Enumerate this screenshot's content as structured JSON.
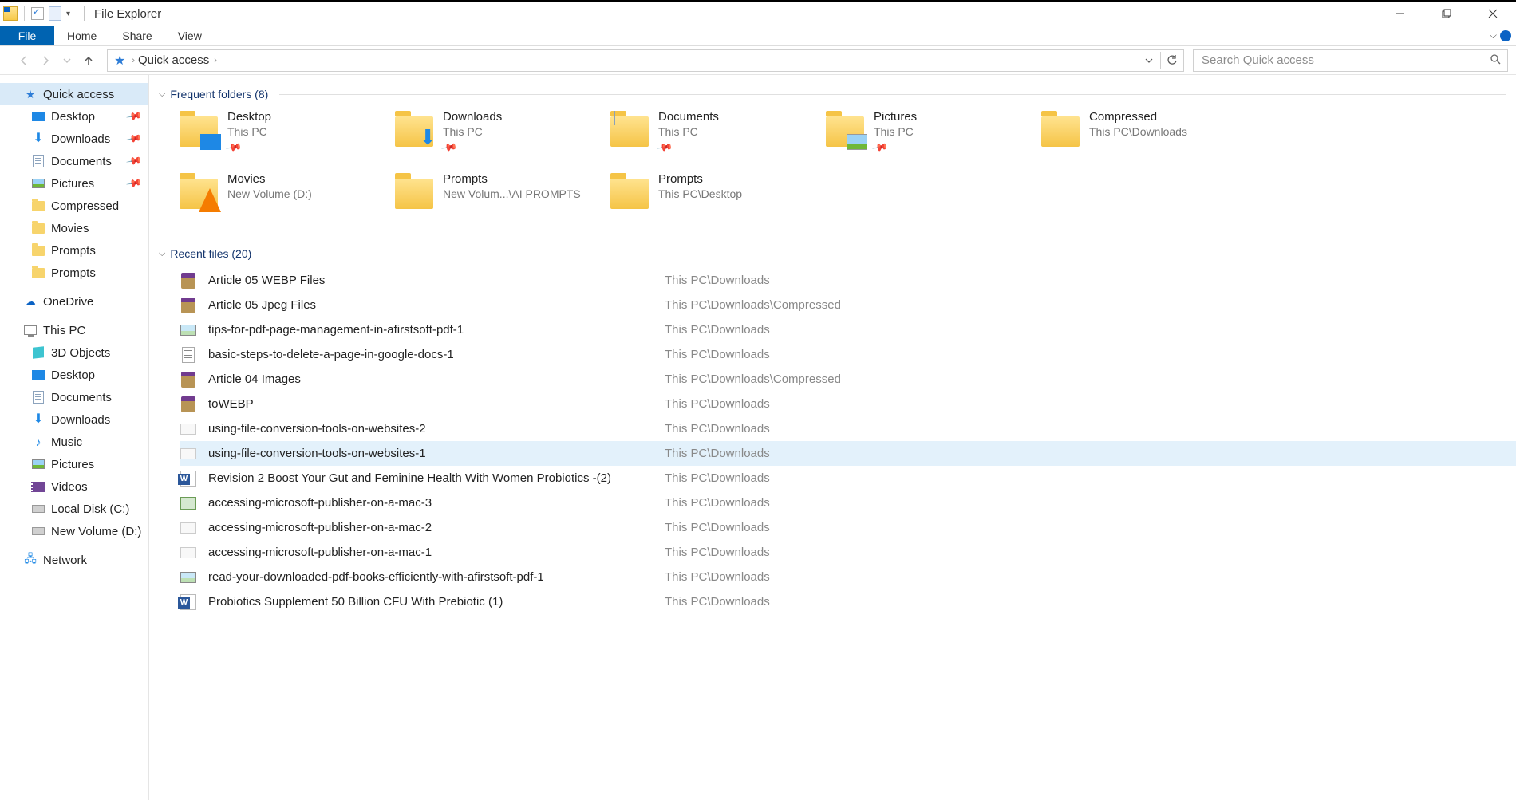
{
  "window": {
    "title": "File Explorer"
  },
  "ribbon": {
    "file": "File",
    "home": "Home",
    "share": "Share",
    "view": "View"
  },
  "address": {
    "location": "Quick access",
    "search_placeholder": "Search Quick access"
  },
  "navpane": {
    "quick_access": "Quick access",
    "qa_items": [
      {
        "label": "Desktop",
        "pinned": true
      },
      {
        "label": "Downloads",
        "pinned": true
      },
      {
        "label": "Documents",
        "pinned": true
      },
      {
        "label": "Pictures",
        "pinned": true
      },
      {
        "label": "Compressed",
        "pinned": false
      },
      {
        "label": "Movies",
        "pinned": false
      },
      {
        "label": "Prompts",
        "pinned": false
      },
      {
        "label": "Prompts",
        "pinned": false
      }
    ],
    "onedrive": "OneDrive",
    "this_pc": "This PC",
    "pc_items": [
      {
        "label": "3D Objects"
      },
      {
        "label": "Desktop"
      },
      {
        "label": "Documents"
      },
      {
        "label": "Downloads"
      },
      {
        "label": "Music"
      },
      {
        "label": "Pictures"
      },
      {
        "label": "Videos"
      },
      {
        "label": "Local Disk (C:)"
      },
      {
        "label": "New Volume (D:)"
      }
    ],
    "network": "Network"
  },
  "section1": {
    "title": "Frequent folders (8)"
  },
  "folders": [
    {
      "name": "Desktop",
      "path": "This PC",
      "pinned": true,
      "overlay": "desktop"
    },
    {
      "name": "Downloads",
      "path": "This PC",
      "pinned": true,
      "overlay": "down"
    },
    {
      "name": "Documents",
      "path": "This PC",
      "pinned": true,
      "overlay": "doc"
    },
    {
      "name": "Pictures",
      "path": "This PC",
      "pinned": true,
      "overlay": "pic"
    },
    {
      "name": "Compressed",
      "path": "This PC\\Downloads",
      "pinned": false,
      "overlay": ""
    },
    {
      "name": "Movies",
      "path": "New Volume (D:)",
      "pinned": false,
      "overlay": "vlc"
    },
    {
      "name": "Prompts",
      "path": "New Volum...\\AI PROMPTS",
      "pinned": false,
      "overlay": ""
    },
    {
      "name": "Prompts",
      "path": "This PC\\Desktop",
      "pinned": false,
      "overlay": ""
    }
  ],
  "section2": {
    "title": "Recent files (20)"
  },
  "files": [
    {
      "name": "Article 05 WEBP Files",
      "path": "This PC\\Downloads",
      "icon": "rar",
      "sel": false
    },
    {
      "name": "Article 05 Jpeg Files",
      "path": "This PC\\Downloads\\Compressed",
      "icon": "rar",
      "sel": false
    },
    {
      "name": "tips-for-pdf-page-management-in-afirstsoft-pdf-1",
      "path": "This PC\\Downloads",
      "icon": "img",
      "sel": false
    },
    {
      "name": "basic-steps-to-delete-a-page-in-google-docs-1",
      "path": "This PC\\Downloads",
      "icon": "txt",
      "sel": false
    },
    {
      "name": "Article 04 Images",
      "path": "This PC\\Downloads\\Compressed",
      "icon": "rar",
      "sel": false
    },
    {
      "name": "toWEBP",
      "path": "This PC\\Downloads",
      "icon": "rar",
      "sel": false
    },
    {
      "name": "using-file-conversion-tools-on-websites-2",
      "path": "This PC\\Downloads",
      "icon": "imgw",
      "sel": false
    },
    {
      "name": "using-file-conversion-tools-on-websites-1",
      "path": "This PC\\Downloads",
      "icon": "imgw",
      "sel": true
    },
    {
      "name": "Revision 2 Boost Your Gut and Feminine Health With Women Probiotics -(2)",
      "path": "This PC\\Downloads",
      "icon": "word",
      "sel": false
    },
    {
      "name": "accessing-microsoft-publisher-on-a-mac-3",
      "path": "This PC\\Downloads",
      "icon": "pbr",
      "sel": false
    },
    {
      "name": "accessing-microsoft-publisher-on-a-mac-2",
      "path": "This PC\\Downloads",
      "icon": "imgw",
      "sel": false
    },
    {
      "name": "accessing-microsoft-publisher-on-a-mac-1",
      "path": "This PC\\Downloads",
      "icon": "imgw",
      "sel": false
    },
    {
      "name": "read-your-downloaded-pdf-books-efficiently-with-afirstsoft-pdf-1",
      "path": "This PC\\Downloads",
      "icon": "img",
      "sel": false
    },
    {
      "name": "Probiotics Supplement 50 Billion CFU With Prebiotic (1)",
      "path": "This PC\\Downloads",
      "icon": "word",
      "sel": false
    }
  ]
}
